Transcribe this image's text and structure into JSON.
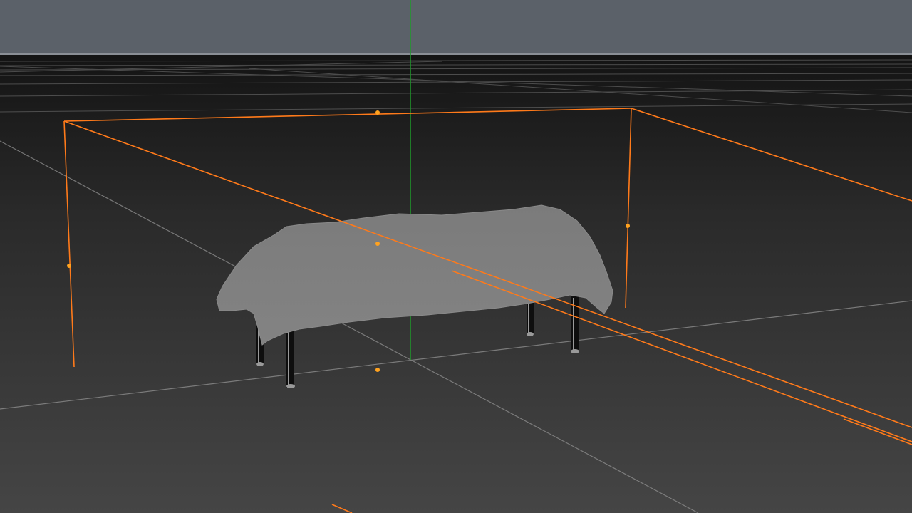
{
  "viewport": {
    "colors": {
      "sky": "#5b6169",
      "horizon_line": "#8a8f96",
      "floor_far": "#141414",
      "floor_near": "#454545",
      "grid_line": "#8c8c8c",
      "y_axis": "#1f9a2a",
      "selection": "#ff7a1a",
      "selection_handle": "#ffa21f",
      "cloth": "#7b7b7b",
      "cloth_edge": "#8a8a8a",
      "table_leg": "#0e0e0e",
      "table_leg_highlight": "#9a9a9a"
    },
    "icons": {
      "axis": "y-axis-line",
      "handle": "bounding-box-handle-icon"
    }
  }
}
